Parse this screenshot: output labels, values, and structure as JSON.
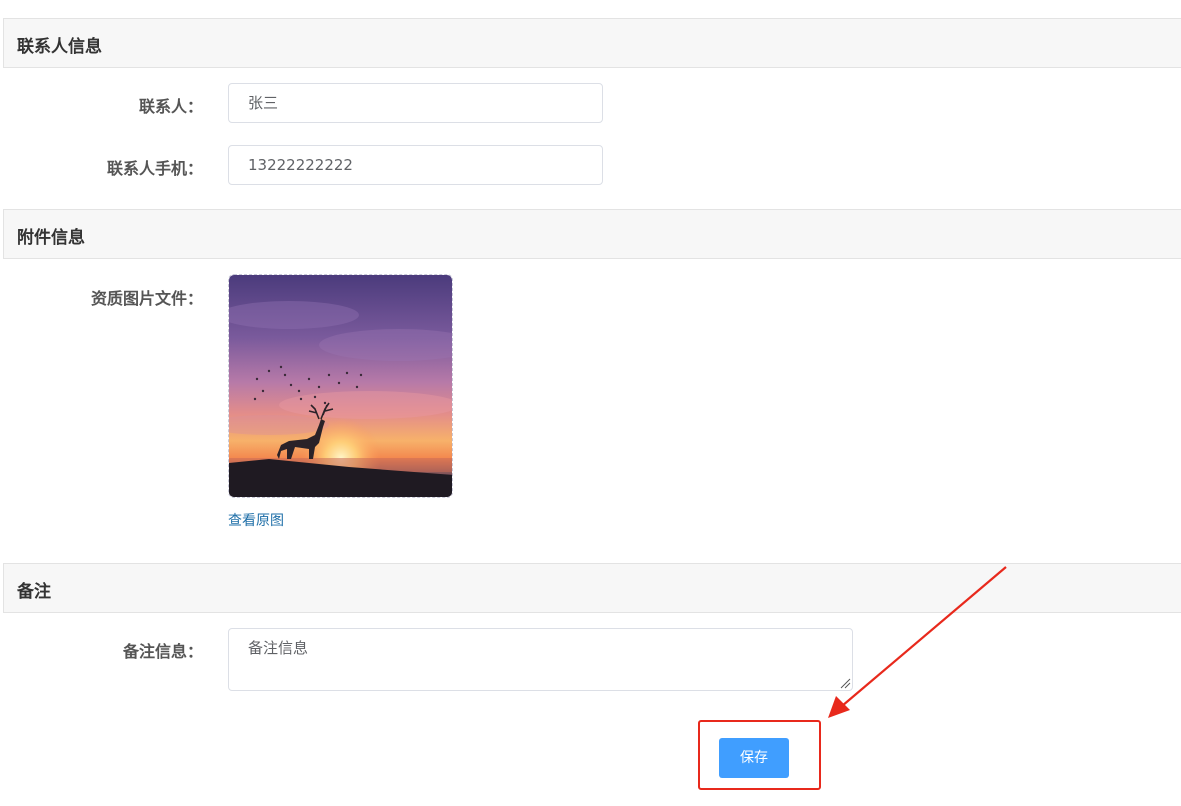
{
  "contact_section": {
    "title": "联系人信息",
    "contact_label": "联系人：",
    "contact_value": "张三",
    "phone_label": "联系人手机：",
    "phone_value": "13222222222"
  },
  "attachment_section": {
    "title": "附件信息",
    "qualification_label": "资质图片文件：",
    "view_original_link": "查看原图"
  },
  "remarks_section": {
    "title": "备注",
    "remarks_label": "备注信息：",
    "remarks_placeholder": "备注信息"
  },
  "actions": {
    "save_label": "保存"
  },
  "colors": {
    "primary_button": "#409eff",
    "annotation_red": "#e8291c",
    "link": "#1f6fa8"
  }
}
